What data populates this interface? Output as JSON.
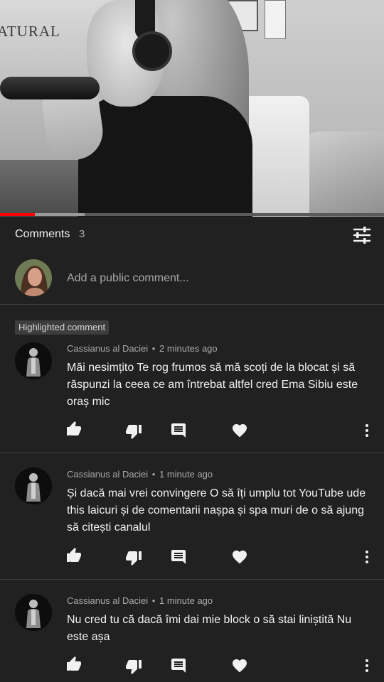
{
  "video": {
    "background_text": "ATURAL",
    "progress_fraction": 0.09,
    "buffer_fraction": 0.22,
    "colors": {
      "played": "#ff0000",
      "buffered": "#9a9a9a",
      "track": "#5a5a5a"
    }
  },
  "comments_section": {
    "title": "Comments",
    "count": "3",
    "sort_icon": "sort-filter-icon"
  },
  "add_comment": {
    "placeholder": "Add a public comment..."
  },
  "comments": [
    {
      "highlighted_badge": "Highlighted comment",
      "author": "Cassianus al Daciei",
      "separator": "•",
      "time": "2 minutes ago",
      "text": "Măi nesimțito Te rog frumos să mă scoți de la blocat și să răspunzi la ceea ce am întrebat altfel cred Ema Sibiu este oraș mic",
      "actions": [
        "like-icon",
        "dislike-icon",
        "reply-icon",
        "heart-icon",
        "more-icon"
      ]
    },
    {
      "author": "Cassianus al Daciei",
      "separator": "•",
      "time": "1 minute ago",
      "text": "Și dacă mai vrei convingere O să îți umplu tot YouTube ude this laicuri și de comentarii nașpa și spa muri de o să ajung să citești canalul",
      "actions": [
        "like-icon",
        "dislike-icon",
        "reply-icon",
        "heart-icon",
        "more-icon"
      ]
    },
    {
      "author": "Cassianus al Daciei",
      "separator": "•",
      "time": "1 minute ago",
      "text": "Nu cred tu că dacă îmi dai mie block o să stai liniștită Nu este așa",
      "actions": [
        "like-icon",
        "dislike-icon",
        "reply-icon",
        "heart-icon",
        "more-icon"
      ]
    }
  ]
}
